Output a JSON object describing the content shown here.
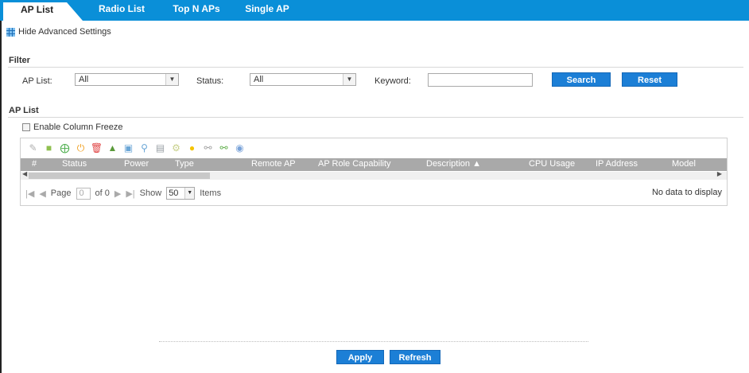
{
  "tabs": [
    {
      "label": "AP List",
      "active": true
    },
    {
      "label": "Radio List"
    },
    {
      "label": "Top N APs"
    },
    {
      "label": "Single AP"
    }
  ],
  "advanced_link": "Hide Advanced Settings",
  "filter": {
    "title": "Filter",
    "ap_list_label": "AP List:",
    "ap_list_value": "All",
    "status_label": "Status:",
    "status_value": "All",
    "keyword_label": "Keyword:",
    "keyword_value": "",
    "search_label": "Search",
    "reset_label": "Reset"
  },
  "ap_list": {
    "title": "AP List",
    "freeze_label": "Enable Column Freeze",
    "columns": [
      "#",
      "Status",
      "Power",
      "Type",
      "Remote AP",
      "AP Role Capability",
      "Description ▲",
      "CPU Usage",
      "IP Address",
      "Model"
    ],
    "toolbar_icons": [
      "edit-icon",
      "add-ap-icon",
      "add-icon",
      "power-icon",
      "delete-icon",
      "user-edit-icon",
      "monitor-icon",
      "wireless-icon",
      "lock-icon",
      "settings-icon",
      "light-icon",
      "map-icon",
      "tag-icon",
      "options-icon"
    ],
    "pager": {
      "page_label": "Page",
      "page_value": "0",
      "of_label": "of 0",
      "show_label": "Show",
      "show_value": "50",
      "items_label": "Items",
      "no_data": "No data to display"
    }
  },
  "footer": {
    "apply_label": "Apply",
    "refresh_label": "Refresh"
  },
  "colors": {
    "tabbar": "#0a8fd8",
    "button": "#1c7fd6",
    "header": "#a9a9a9"
  }
}
